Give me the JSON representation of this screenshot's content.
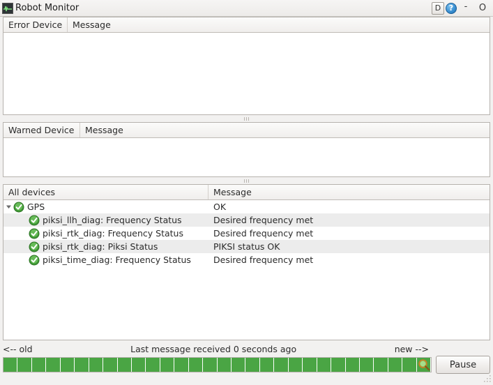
{
  "window": {
    "title": "Robot Monitor",
    "icon": "waveform-icon",
    "buttons": {
      "debug_label": "D",
      "help_label": "?",
      "minimize_label": "-",
      "maximize_label": "O"
    }
  },
  "error_panel": {
    "columns": [
      "Error Device",
      "Message"
    ],
    "rows": []
  },
  "warned_panel": {
    "columns": [
      "Warned Device",
      "Message"
    ],
    "rows": []
  },
  "all_panel": {
    "columns": [
      "All devices",
      "Message"
    ],
    "rows": [
      {
        "label": "GPS",
        "message": "OK",
        "status": "ok-check-icon",
        "level": 0,
        "expanded": true,
        "striped": false
      },
      {
        "label": "piksi_llh_diag: Frequency Status",
        "message": "Desired frequency met",
        "status": "ok-check-icon",
        "level": 1,
        "expanded": null,
        "striped": true
      },
      {
        "label": "piksi_rtk_diag: Frequency Status",
        "message": "Desired frequency met",
        "status": "ok-check-icon",
        "level": 1,
        "expanded": null,
        "striped": false
      },
      {
        "label": "piksi_rtk_diag: Piksi Status",
        "message": "PIKSI status OK",
        "status": "ok-check-icon",
        "level": 1,
        "expanded": null,
        "striped": true
      },
      {
        "label": "piksi_time_diag: Frequency Status",
        "message": "Desired frequency met",
        "status": "ok-check-icon",
        "level": 1,
        "expanded": null,
        "striped": false
      }
    ]
  },
  "status_bar": {
    "old_label": "<-- old",
    "message": "Last message received 0 seconds ago",
    "new_label": "new -->",
    "pause_label": "Pause",
    "magnifier_icon": "magnifier-icon",
    "timeline": {
      "cell_count": 30,
      "cell_color": "#4aa544",
      "cells": [
        "ok",
        "ok",
        "ok",
        "ok",
        "ok",
        "ok",
        "ok",
        "ok",
        "ok",
        "ok",
        "ok",
        "ok",
        "ok",
        "ok",
        "ok",
        "ok",
        "ok",
        "ok",
        "ok",
        "ok",
        "ok",
        "ok",
        "ok",
        "ok",
        "ok",
        "ok",
        "ok",
        "ok",
        "ok",
        "ok"
      ]
    }
  },
  "colors": {
    "ok_green": "#4aa544",
    "window_bg": "#f2f1f0",
    "panel_bg": "#ffffff",
    "stripe": "#ececec",
    "text": "#2b2b2b"
  }
}
